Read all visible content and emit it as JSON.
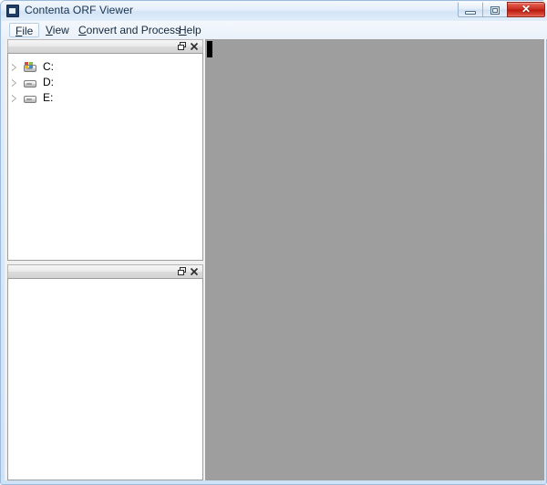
{
  "window": {
    "title": "Contenta ORF Viewer",
    "app_icon": "app-window-icon",
    "controls": {
      "minimize": "minimize-icon",
      "maximize": "maximize-restore-icon",
      "close_label": "✕"
    }
  },
  "menubar": {
    "items": [
      {
        "label": "File",
        "accel": "F",
        "prefix": "",
        "suffix": "ile",
        "selected": true
      },
      {
        "label": "View",
        "accel": "V",
        "prefix": "",
        "suffix": "iew",
        "selected": false
      },
      {
        "label": "Convert and Process",
        "accel": "C",
        "prefix": "",
        "suffix": "onvert and Process",
        "selected": false
      },
      {
        "label": "Help",
        "accel": "H",
        "prefix": "",
        "suffix": "elp",
        "selected": false
      }
    ]
  },
  "panels": {
    "folders": {
      "name": "folder-tree-panel",
      "float_icon": "float-panel-icon",
      "close_icon": "close-panel-icon",
      "tree": [
        {
          "label": "C:",
          "icon": "system-drive-icon",
          "expanded": false,
          "is_system": true
        },
        {
          "label": "D:",
          "icon": "drive-icon",
          "expanded": false,
          "is_system": false
        },
        {
          "label": "E:",
          "icon": "drive-icon",
          "expanded": false,
          "is_system": false
        }
      ]
    },
    "files": {
      "name": "file-list-panel",
      "float_icon": "float-panel-icon",
      "close_icon": "close-panel-icon",
      "items": []
    }
  },
  "preview": {
    "name": "image-preview-pane",
    "background_color": "#9e9e9e",
    "content": ""
  },
  "colors": {
    "title_bar_start": "#f2f8fd",
    "title_bar_end": "#d3e4f6",
    "frame_border": "#9dbbdc",
    "close_button_red": "#c62b1c",
    "preview_gray": "#9e9e9e",
    "panel_header_gray": "#e2e2e2",
    "panel_body_white": "#ffffff"
  }
}
